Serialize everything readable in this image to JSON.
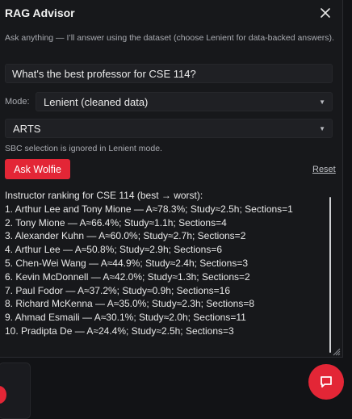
{
  "panel": {
    "title": "RAG Advisor",
    "description": "Ask anything — I’ll answer using the dataset (choose Lenient for data-backed answers).",
    "question_value": "What's the best professor for CSE 114?",
    "mode_label": "Mode:",
    "mode_value": "Lenient (cleaned data)",
    "sbc_value": "ARTS",
    "sbc_note": "SBC selection is ignored in Lenient mode.",
    "ask_label": "Ask Wolfie",
    "reset_label": "Reset"
  },
  "result": {
    "heading": "Instructor ranking for CSE 114 (best → worst):",
    "lines": [
      "1. Arthur Lee and Tony Mione — A≈78.3%; Study≈2.5h; Sections=1",
      "2. Tony Mione — A≈66.4%; Study≈1.1h; Sections=4",
      "3. Alexander Kuhn — A≈60.0%; Study≈2.7h; Sections=2",
      "4. Arthur Lee — A≈50.8%; Study≈2.9h; Sections=6",
      "5. Chen-Wei Wang — A≈44.9%; Study≈2.4h; Sections=3",
      "6. Kevin McDonnell — A≈42.0%; Study≈1.3h; Sections=2",
      "7. Paul Fodor — A≈37.2%; Study≈0.9h; Sections=16",
      "8. Richard McKenna — A≈35.0%; Study≈2.3h; Sections=8",
      "9. Ahmad Esmaili — A≈30.1%; Study≈2.0h; Sections=11",
      "10. Pradipta De — A≈24.4%; Study≈2.5h; Sections=3"
    ]
  },
  "icons": {
    "close": "close-icon",
    "caret": "chevron-down-icon",
    "chat": "chat-bubble-icon"
  },
  "colors": {
    "accent": "#e32636",
    "panel_bg": "#17181b",
    "input_bg": "#1f2024"
  }
}
